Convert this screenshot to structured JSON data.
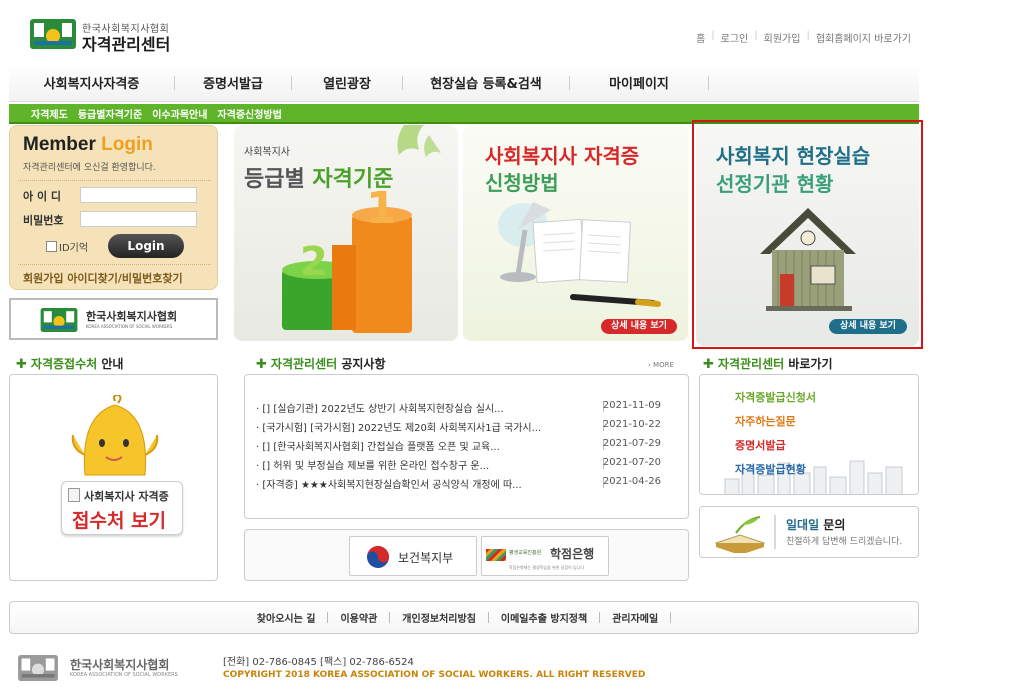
{
  "header": {
    "logo_top": "한국사회복지사협회",
    "logo_bottom": "자격관리센터",
    "top_links": [
      "홈",
      "로그인",
      "회원가입",
      "협회홈페이지 바로가기"
    ]
  },
  "gnb": [
    "사회복지사자격증",
    "증명서발급",
    "열린광장",
    "현장실습 등록&검색",
    "마이페이지"
  ],
  "subnav": [
    "자격제도",
    "등급별자격기준",
    "이수과목안내",
    "자격증신청방법"
  ],
  "login": {
    "title_a": "Member",
    "title_b": "Login",
    "welcome": "자격관리센터에 오신걸 환영합니다.",
    "id_label": "아 이 디",
    "pw_label": "비밀번호",
    "remember_label": "ID기억",
    "button": "Login",
    "links": "회원가입   아이디찾기/비밀번호찾기"
  },
  "kasw_banner": {
    "ko": "한국사회복지사협회",
    "en": "KOREA ASSOCIATION OF SOCIAL WORKERS"
  },
  "banners": {
    "b1": {
      "small": "사회복지사",
      "big_a": "등급별",
      "big_b": "자격기준",
      "n1": "1",
      "n2": "2"
    },
    "b2": {
      "line1": "사회복지사 자격증",
      "line2": "신청방법",
      "more": "상세 내용 보기"
    },
    "b3": {
      "line1": "사회복지 현장실습",
      "line2": "선정기관 현황",
      "more": "상세 내용 보기"
    }
  },
  "section_reception": {
    "title_g": "자격증접수처",
    "title_rest": " 안내",
    "card_small": "사회복지사 자격증",
    "card_big": "접수처 보기"
  },
  "notice": {
    "title_g": "자격관리센터",
    "title_rest": " 공지사항",
    "more": "› MORE",
    "rows": [
      {
        "text": "· []  [실습기관] 2022년도 상반기 사회복지현장실습 실시...",
        "date": "2021-11-09"
      },
      {
        "text": "· [국가시험]  [국가시험] 2022년도 제20회 사회복지사1급 국가시...",
        "date": "2021-10-22"
      },
      {
        "text": "· []  [한국사회복지사협회] 간접실습 플랫폼 오픈 및 교육...",
        "date": "2021-07-29"
      },
      {
        "text": "· []  허위 및 부정실습 제보를 위한 온라인 접수창구 운...",
        "date": "2021-07-20"
      },
      {
        "text": "· [자격증]  ★★★사회복지현장실습확인서 공식양식 개정에 따...",
        "date": "2021-04-26"
      }
    ]
  },
  "partners": {
    "mohw": "보건복지부",
    "bank_small": "평생교육진흥원",
    "bank_big": "학점은행",
    "bank_sub": "학점은행제는 평생학습을 위한 길잡이 입니다"
  },
  "quick": {
    "title_g": "자격관리센터",
    "title_rest": " 바로가기",
    "links": [
      {
        "label": "자격증발급신청서",
        "color": "#6aa82a"
      },
      {
        "label": "자주하는질문",
        "color": "#e07a14"
      },
      {
        "label": "증명서발급",
        "color": "#d62a2a"
      },
      {
        "label": "자격증발급현황",
        "color": "#2a6aa8"
      }
    ]
  },
  "ask": {
    "title_a": "일대일",
    "title_b": " 문의",
    "sub": "친절하게 답변해 드리겠습니다."
  },
  "footer": {
    "links": [
      "찾아오시는 길",
      "이용약관",
      "개인정보처리방침",
      "이메일추출 방지정책",
      "관리자메일"
    ],
    "logo_ko": "한국사회복지사협회",
    "logo_en": "KOREA ASSOCIATION OF SOCIAL WORKERS",
    "contact": "[전화] 02-786-0845  [팩스] 02-786-6524",
    "copyright": "COPYRIGHT 2018 KOREA ASSOCIATION OF SOCIAL WORKERS. ALL RIGHT RESERVED"
  },
  "colors": {
    "green": "#5fb42a",
    "accent_orange": "#f0a020",
    "highlight_red": "#d61616",
    "teal": "#1f6f8b"
  }
}
